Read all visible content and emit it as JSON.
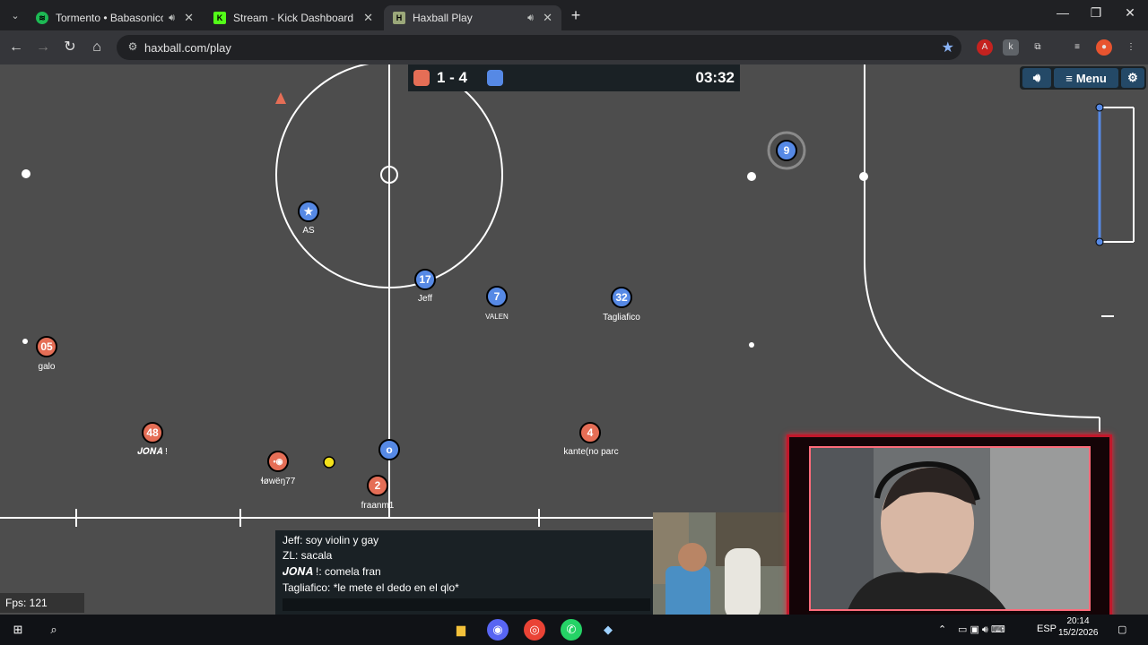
{
  "browser": {
    "tabs": [
      {
        "title": "Tormento • Babasonicos",
        "favicon": "spotify-icon",
        "color": "#1db954"
      },
      {
        "title": "Stream - Kick Dashboard",
        "favicon": "kick-icon",
        "color": "#53fc18"
      },
      {
        "title": "Haxball Play",
        "favicon": "haxball-icon",
        "color": "#9ba87a"
      }
    ],
    "url": "haxball.com/play"
  },
  "scoreboard": {
    "score": "1 - 4",
    "time": "03:32",
    "red_color": "#e56e56",
    "blue_color": "#5689e5"
  },
  "menu": {
    "label": "Menu"
  },
  "players": [
    {
      "number": "★",
      "name": "AS",
      "team": "blue"
    },
    {
      "number": "17",
      "name": "Jeff",
      "team": "blue"
    },
    {
      "number": "7",
      "name": "VALEN",
      "team": "blue"
    },
    {
      "number": "32",
      "name": "Tagliafico",
      "team": "blue"
    },
    {
      "number": "9",
      "name": "",
      "team": "blue"
    },
    {
      "number": "o",
      "name": "",
      "team": "blue"
    },
    {
      "number": "05",
      "name": "galo",
      "team": "red"
    },
    {
      "number": "48",
      "name": "𝑱𝑶𝑵𝑨 !",
      "team": "red"
    },
    {
      "number": "•◉",
      "name": "ɬøwëŋ77",
      "team": "red"
    },
    {
      "number": "2",
      "name": "fraanm1",
      "team": "red"
    },
    {
      "number": "4",
      "name": "kante(no parc",
      "team": "red"
    }
  ],
  "chat": [
    "Jeff: soy violin y gay",
    "ZL: sacala",
    "𝑱𝑶𝑵𝑨 !: comela fran",
    "Tagliafico: *le mete el dedo en el qlo*"
  ],
  "fps": "Fps: 121",
  "taskbar": {
    "lang": "ESP",
    "time": "20:14",
    "date": "15/2/2026"
  }
}
